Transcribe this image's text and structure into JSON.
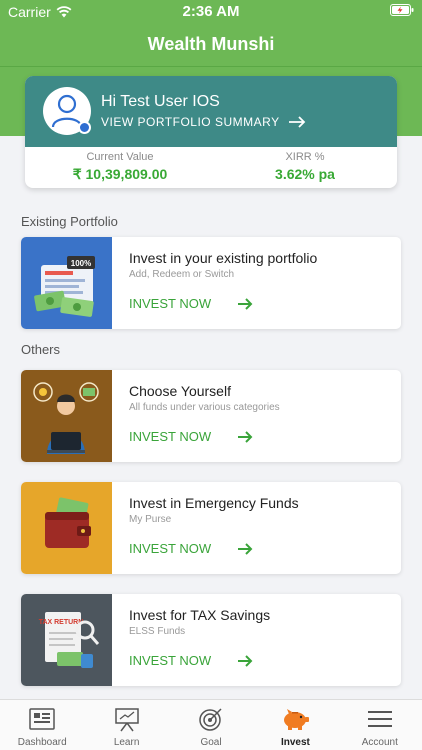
{
  "status_bar": {
    "carrier": "Carrier",
    "time": "2:36 AM"
  },
  "header": {
    "title": "Wealth Munshi"
  },
  "summary": {
    "greeting": "Hi Test User IOS",
    "view_link": "VIEW PORTFOLIO SUMMARY",
    "current_value_label": "Current Value",
    "current_value": "₹ 10,39,809.00",
    "xirr_label": "XIRR %",
    "xirr_value": "3.62% pa"
  },
  "sections": {
    "existing": "Existing Portfolio",
    "others": "Others"
  },
  "cards": [
    {
      "title": "Invest in your existing portfolio",
      "subtitle": "Add, Redeem or Switch",
      "cta": "INVEST NOW",
      "badge": "100%"
    },
    {
      "title": "Choose Yourself",
      "subtitle": "All funds under various categories",
      "cta": "INVEST NOW"
    },
    {
      "title": "Invest in Emergency Funds",
      "subtitle": "My Purse",
      "cta": "INVEST NOW"
    },
    {
      "title": "Invest for TAX Savings",
      "subtitle": "ELSS Funds",
      "cta": "INVEST NOW",
      "badge": "TAX RETURN"
    }
  ],
  "tabs": [
    {
      "label": "Dashboard",
      "icon": "dashboard-icon"
    },
    {
      "label": "Learn",
      "icon": "learn-icon"
    },
    {
      "label": "Goal",
      "icon": "goal-icon"
    },
    {
      "label": "Invest",
      "icon": "piggy-bank-icon"
    },
    {
      "label": "Account",
      "icon": "menu-icon"
    }
  ],
  "colors": {
    "brand_green": "#6db855",
    "teal": "#3e8a87",
    "cta_green": "#3aa43a",
    "invest_orange": "#f07c22"
  }
}
